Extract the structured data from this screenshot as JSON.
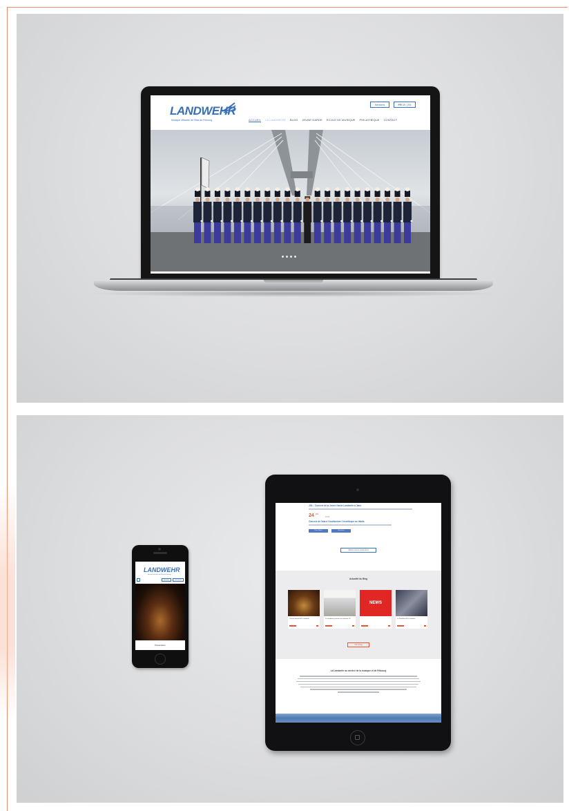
{
  "laptop_site": {
    "logo": "LANDWEHR",
    "tagline": "Musique officielle de l'Etat de Fribourg",
    "member_button": "Membres",
    "lang": {
      "active": "FR",
      "others": "DE | EN"
    },
    "nav": [
      "Accueil",
      "La Landwehr",
      "Blog",
      "Jeune Garde",
      "Ecole de musique",
      "Philatheque",
      "Contact"
    ],
    "nav_active_index": 0
  },
  "phone_site": {
    "logo": "LANDWEHR",
    "tagline": "Musique officielle de l'Etat de Fribourg",
    "buttons": [
      "Membres",
      "FR DE EN"
    ],
    "caption": "Présentation"
  },
  "tablet_site": {
    "event1_title": "JGL - Concert de la Jeune Garde Landwehr à Jaun",
    "event2_day": "24",
    "event2_month": "MAI",
    "event2_time": "19:00",
    "event2_title": "Concert de Gala à l'Auditorium Cricothèque au Valais",
    "event_buttons": [
      "Plus d'infos",
      "Réserver"
    ],
    "all_events_button": "Afficher tous les événements",
    "blog_title": "Actualité du Blog",
    "blog_cards": [
      {
        "caption": "Concert annuel de la Landwehr",
        "image": "concert-hall"
      },
      {
        "caption": "La Landwehr présente son nouveau CD",
        "image": "newspaper"
      },
      {
        "caption": "NEWS",
        "image": "news-red"
      },
      {
        "caption": "Le Président de la Landwehr",
        "image": "people"
      }
    ],
    "blog_button": "Voir le blog",
    "about_title": "La Landwehr au service de la musique et de Fribourg"
  },
  "colors": {
    "brand_blue": "#3a6fb5",
    "accent_orange": "#e8542f",
    "news_red": "#e02724"
  }
}
